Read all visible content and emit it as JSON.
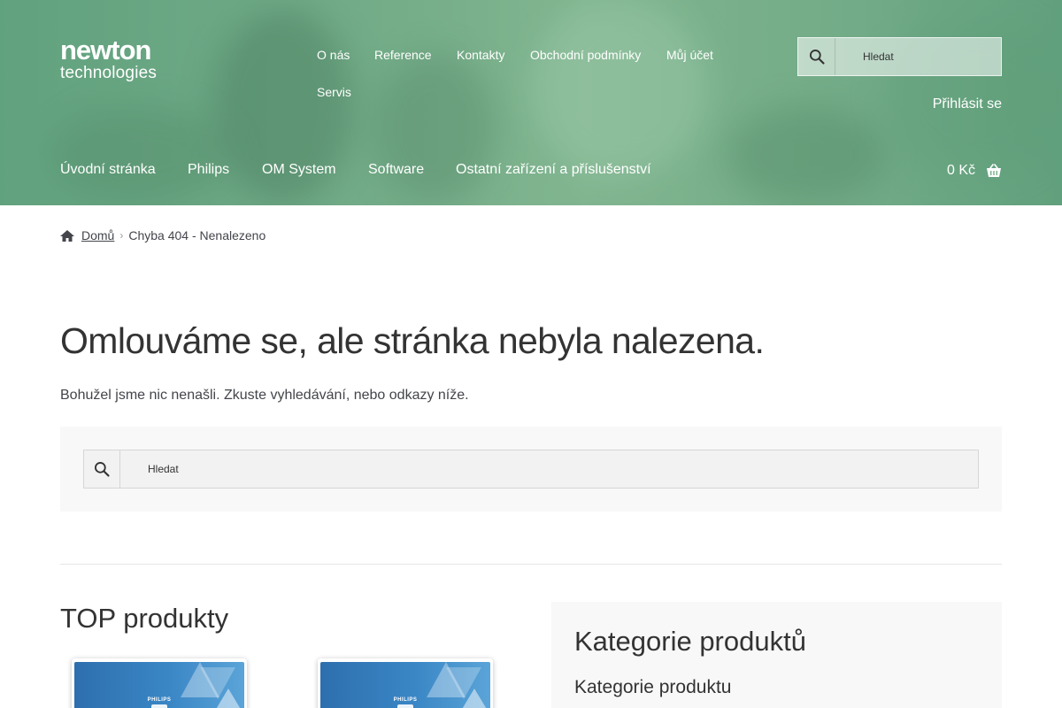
{
  "brand": {
    "logo_line1": "newton",
    "logo_line2": "technologies"
  },
  "secondary_nav": [
    {
      "label": "O nás"
    },
    {
      "label": "Reference"
    },
    {
      "label": "Kontakty"
    },
    {
      "label": "Obchodní podmínky"
    },
    {
      "label": "Můj účet"
    },
    {
      "label": "Servis"
    }
  ],
  "header_search": {
    "placeholder": "Hledat",
    "icon": "search-icon"
  },
  "login": {
    "label": "Přihlásit se"
  },
  "main_nav": [
    {
      "label": "Úvodní stránka"
    },
    {
      "label": "Philips"
    },
    {
      "label": "OM System"
    },
    {
      "label": "Software"
    },
    {
      "label": "Ostatní zařízení a příslušenství"
    }
  ],
  "cart": {
    "total": "0 Kč",
    "icon": "basket-icon"
  },
  "breadcrumb": {
    "home_label": "Domů",
    "home_icon": "home-icon",
    "current": "Chyba 404 - Nenalezeno"
  },
  "page": {
    "title": "Omlouváme se, ale stránka nebyla nalezena.",
    "lead": "Bohužel jsme nic nenašli. Zkuste vyhledávání, nebo odkazy níže."
  },
  "content_search": {
    "placeholder": "Hledat",
    "icon": "search-icon"
  },
  "top_products": {
    "title": "TOP produkty",
    "items": [
      {
        "brand": "PHILIPS"
      },
      {
        "brand": "PHILIPS"
      }
    ]
  },
  "categories": {
    "title": "Kategorie produktů",
    "subtitle": "Kategorie produktu"
  },
  "colors": {
    "header_green": "#7aae8c",
    "text_dark": "#333333",
    "text_body": "#43454b",
    "panel_bg": "#f8f8f8",
    "product_blue": "#3a86c5"
  }
}
